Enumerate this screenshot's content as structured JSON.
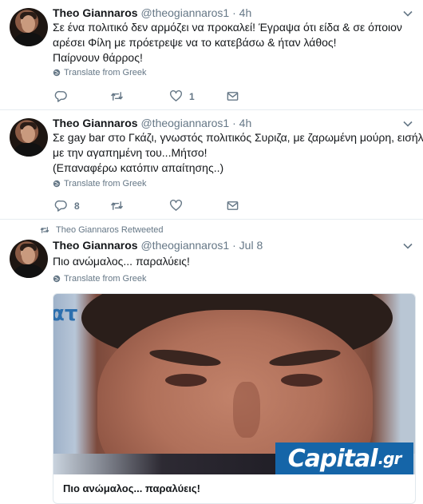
{
  "tweets": [
    {
      "name": "Theo Giannaros",
      "handle": "@theogiannaros1",
      "separator": "·",
      "time": "4h",
      "lines": [
        "Σε ένα πολιτικό δεν αρμόζει να προκαλεί! Έγραψα ότι είδα & σε όποιον",
        "αρέσει Φίλη με πρόετρεψε να το κατεβάσω & ήταν λάθος!",
        "Παίρνουν θάρρος!"
      ],
      "translate": "Translate from Greek",
      "reply_count": "",
      "retweet_count": "",
      "like_count": "1"
    },
    {
      "name": "Theo Giannaros",
      "handle": "@theogiannaros1",
      "separator": "·",
      "time": "4h",
      "lines": [
        "Σε gay bar στο Γκάζι, γνωστός πολιτικός Συριζα, με ζαρωμένη μούρη, εισήλθε",
        "με την αγαπημένη του...Μήτσο!",
        "(Επαναφέρω κατόπιν απαίτησης..)"
      ],
      "translate": "Translate from Greek",
      "reply_count": "8",
      "retweet_count": "",
      "like_count": ""
    },
    {
      "retweeted_label": "Theo Giannaros Retweeted",
      "name": "Theo Giannaros",
      "handle": "@theogiannaros1",
      "separator": "·",
      "time": "Jul 8",
      "lines": [
        "Πιο ανώμαλος... παραλύεις!"
      ],
      "translate": "Translate from Greek",
      "card": {
        "logo_main": "Capital",
        "logo_suffix": ".gr",
        "image_partial_text": "ατ",
        "title": "Πιο ανώμαλος... παραλύεις!"
      }
    }
  ],
  "icons": {
    "reply": "reply-icon",
    "retweet": "retweet-icon",
    "like": "heart-icon",
    "message": "envelope-icon",
    "translate": "globe-icon",
    "caret": "chevron-down-icon"
  },
  "colors": {
    "text": "#14171a",
    "secondary": "#657786",
    "divider": "#e6ecf0",
    "capital_blue": "#1565a8"
  }
}
